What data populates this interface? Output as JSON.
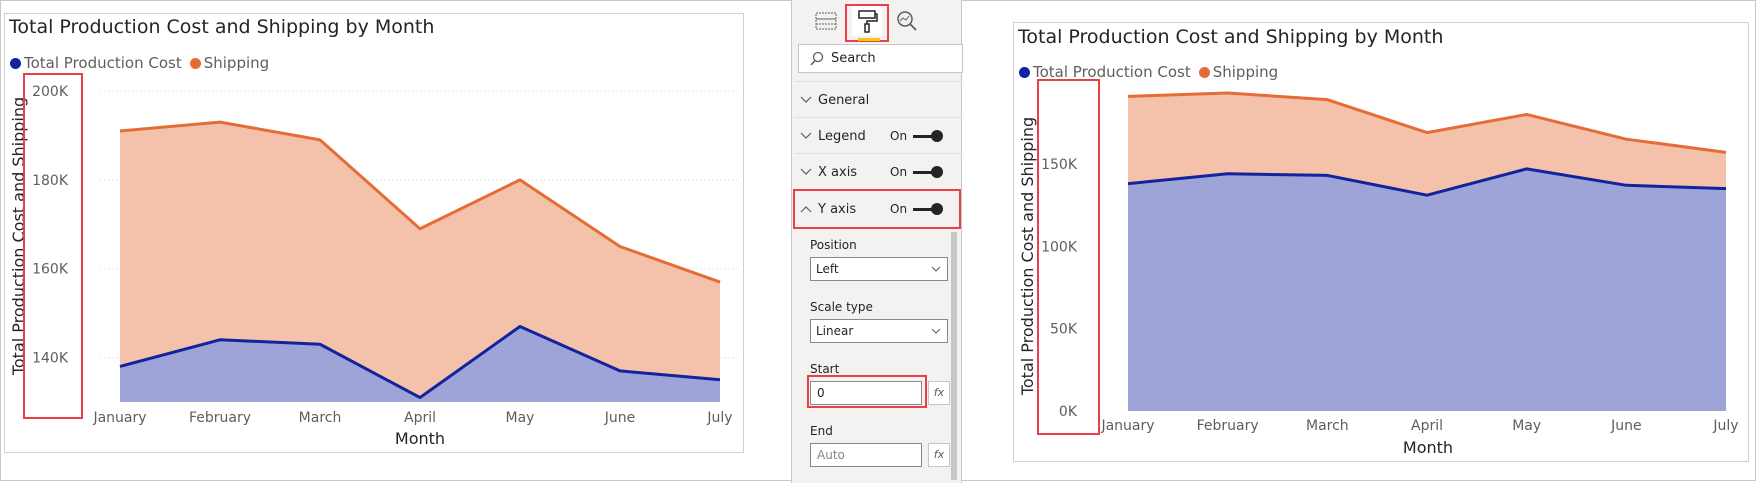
{
  "left_chart": {
    "title": "Total Production Cost and Shipping by Month",
    "legend": [
      {
        "label": "Total Production Cost",
        "color": "#12239e"
      },
      {
        "label": "Shipping",
        "color": "#e66c37"
      }
    ],
    "ylabel": "Total Production Cost and Shipping",
    "xlabel": "Month",
    "yticks": [
      "200K",
      "180K",
      "160K",
      "140K"
    ],
    "categories": [
      "January",
      "February",
      "March",
      "April",
      "May",
      "June",
      "July"
    ]
  },
  "format_pane": {
    "tabs": [
      {
        "icon": "table-grid-icon"
      },
      {
        "icon": "paint-roller-icon",
        "active": true
      },
      {
        "icon": "analytics-magnifier-icon"
      }
    ],
    "search_placeholder": "Search",
    "cards": [
      {
        "name": "General",
        "expanded": false,
        "toggle": ""
      },
      {
        "name": "Legend",
        "expanded": false,
        "toggle": "On"
      },
      {
        "name": "X axis",
        "expanded": false,
        "toggle": "On"
      },
      {
        "name": "Y axis",
        "expanded": true,
        "toggle": "On"
      }
    ],
    "y_axis": {
      "position_label": "Position",
      "position_value": "Left",
      "scale_type_label": "Scale type",
      "scale_type_value": "Linear",
      "start_label": "Start",
      "start_value": "0",
      "end_label": "End",
      "end_placeholder": "Auto",
      "fx_label": "fx"
    }
  },
  "right_chart": {
    "title": "Total Production Cost and Shipping by Month",
    "legend": [
      {
        "label": "Total Production Cost",
        "color": "#12239e"
      },
      {
        "label": "Shipping",
        "color": "#e66c37"
      }
    ],
    "ylabel": "Total Production Cost and Shipping",
    "xlabel": "Month",
    "yticks": [
      "150K",
      "100K",
      "50K",
      "0K"
    ],
    "categories": [
      "January",
      "February",
      "March",
      "April",
      "May",
      "June",
      "July"
    ]
  },
  "chart_data": [
    {
      "type": "area",
      "title": "Total Production Cost and Shipping by Month",
      "xlabel": "Month",
      "ylabel": "Total Production Cost and Shipping",
      "categories": [
        "January",
        "February",
        "March",
        "April",
        "May",
        "June",
        "July"
      ],
      "ylim": [
        130000,
        200000
      ],
      "grid": true,
      "legend_position": "top-left",
      "series": [
        {
          "name": "Total Production Cost",
          "values": [
            138000,
            144000,
            143000,
            131000,
            147000,
            137000,
            135000
          ],
          "color": "#12239e"
        },
        {
          "name": "Shipping",
          "values": [
            191000,
            193000,
            189000,
            169000,
            180000,
            165000,
            157000
          ],
          "color": "#e66c37"
        }
      ]
    },
    {
      "type": "area",
      "title": "Total Production Cost and Shipping by Month",
      "xlabel": "Month",
      "ylabel": "Total Production Cost and Shipping",
      "categories": [
        "January",
        "February",
        "March",
        "April",
        "May",
        "June",
        "July"
      ],
      "ylim": [
        0,
        190000
      ],
      "grid": false,
      "legend_position": "top-left",
      "series": [
        {
          "name": "Total Production Cost",
          "values": [
            138000,
            144000,
            143000,
            131000,
            147000,
            137000,
            135000
          ],
          "color": "#12239e"
        },
        {
          "name": "Shipping",
          "values": [
            191000,
            193000,
            189000,
            169000,
            180000,
            165000,
            157000
          ],
          "color": "#e66c37"
        }
      ]
    }
  ]
}
